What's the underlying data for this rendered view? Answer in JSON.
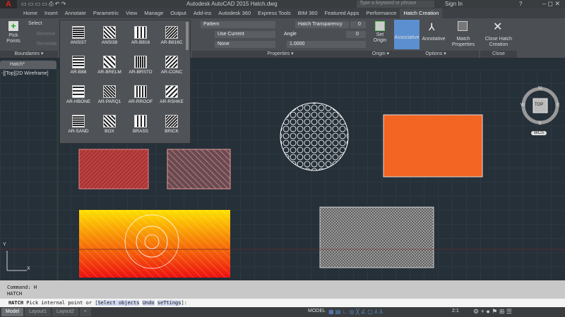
{
  "titlebar": {
    "logo": "A",
    "title": "Autodesk AutoCAD 2015    Hatch.dwg",
    "search_placeholder": "Type a keyword or phrase",
    "sign_in": "Sign In"
  },
  "tabs": [
    "Home",
    "Insert",
    "Annotate",
    "Parametric",
    "View",
    "Manage",
    "Output",
    "Add-ins",
    "Autodesk 360",
    "Express Tools",
    "BIM 360",
    "Featured Apps",
    "Performance",
    "Hatch Creation"
  ],
  "ribbon": {
    "boundaries": {
      "pick_points": "Pick Points",
      "select": "Select",
      "remove": "Remove",
      "recreate": "Recreate",
      "label": "Boundaries ▾"
    },
    "properties": {
      "type": "Pattern",
      "color": "Use Current",
      "background": "None",
      "transparency_label": "Hatch Transparency",
      "transparency": "0",
      "angle_label": "Angle",
      "angle": "0",
      "scale": "1.0000",
      "label": "Properties ▾"
    },
    "origin": {
      "set_origin": "Set Origin",
      "label": "Origin ▾"
    },
    "options": {
      "associative": "Associative",
      "annotative": "Annotative",
      "match": "Match Properties",
      "label": "Options ▾"
    },
    "close": {
      "button": "Close Hatch Creation",
      "label": "Close"
    }
  },
  "patterns": [
    "ANSI37",
    "ANSI38",
    "AR-B816",
    "AR-B816C",
    "AR-B88",
    "AR-BRELM",
    "AR-BRSTD",
    "AR-CONC",
    "AR-HBONE",
    "AR-PARQ1",
    "AR-RROOF",
    "AR-RSHKE",
    "AR-SAND",
    "BOX",
    "BRASS",
    "BRICK"
  ],
  "file_tab": "Hatch*",
  "viewport_label": "-][Top][2D Wireframe]",
  "viewcube": {
    "n": "N",
    "s": "S",
    "e": "E",
    "w": "W",
    "top": "TOP",
    "wcs": "WCS"
  },
  "ucs": {
    "x": "X",
    "y": "Y"
  },
  "command": {
    "history": [
      "Command: H",
      "HATCH"
    ],
    "prompt_cmd": "HATCH",
    "prompt_text": "Pick internal point or [",
    "opt1": "Select objects",
    "opt2": "Undo",
    "opt3": "seTtings",
    "prompt_end": "]:"
  },
  "layouts": [
    "Model",
    "Layout1",
    "Layout2",
    "+"
  ],
  "status": {
    "model": "MODEL",
    "scale": "2:1"
  },
  "colors": {
    "orange": "#f26522",
    "accent": "#5b8fd0"
  }
}
